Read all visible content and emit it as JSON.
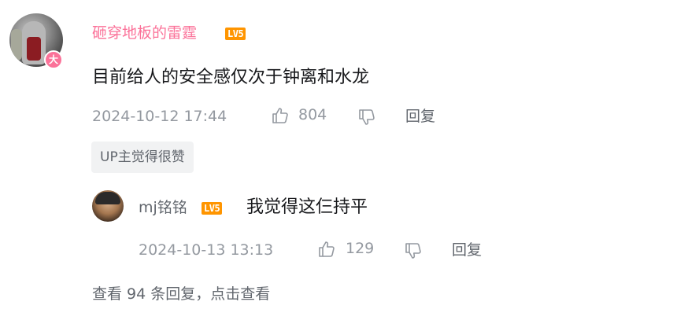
{
  "comment": {
    "username": "砸穿地板的雷霆",
    "level": "LV5",
    "vip_badge": "大",
    "content": "目前给人的安全感仅次于钟离和水龙",
    "time": "2024-10-12 17:44",
    "likes": "804",
    "reply_label": "回复",
    "up_tag": "UP主觉得很赞"
  },
  "reply": {
    "username": "mj铭铭",
    "level": "LV5",
    "content": "我觉得这仨持平",
    "time": "2024-10-13 13:13",
    "likes": "129",
    "reply_label": "回复"
  },
  "view_more": "查看 94 条回复，点击查看",
  "colors": {
    "vip_name": "#fb7299",
    "level_badge": "#ff9500",
    "meta_text": "#9499a0"
  }
}
